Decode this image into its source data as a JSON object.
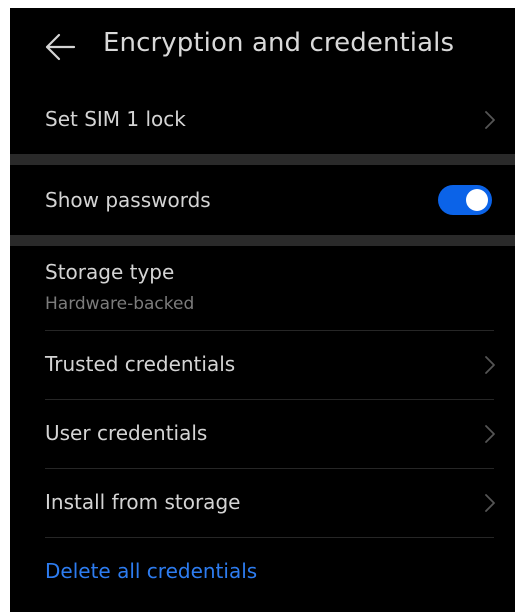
{
  "header": {
    "title": "Encryption and credentials"
  },
  "items": {
    "sim_lock": {
      "label": "Set SIM 1 lock"
    },
    "show_passwords": {
      "label": "Show passwords",
      "enabled": true
    },
    "storage_type": {
      "label": "Storage type",
      "value": "Hardware-backed"
    },
    "trusted_credentials": {
      "label": "Trusted credentials"
    },
    "user_credentials": {
      "label": "User credentials"
    },
    "install_from_storage": {
      "label": "Install from storage"
    },
    "delete_all": {
      "label": "Delete all credentials"
    }
  },
  "colors": {
    "background": "#000000",
    "section_gap": "#2a2a2a",
    "accent": "#0b63e8",
    "link": "#2d7cf0",
    "primary_text": "#d4d4d4",
    "secondary_text": "#7c7c7c"
  },
  "icons": {
    "back": "arrow-left-icon",
    "chevron": "chevron-right-icon"
  }
}
